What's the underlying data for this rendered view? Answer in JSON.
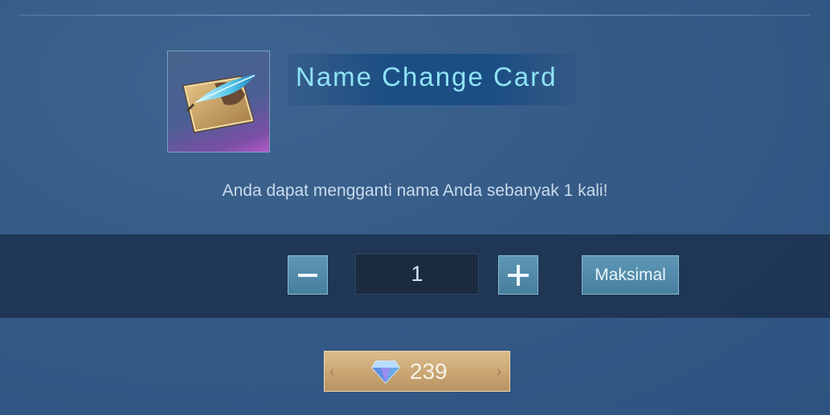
{
  "item": {
    "name": "Name Change Card",
    "description": "Anda dapat mengganti nama Anda sebanyak 1 kali!",
    "icon": "name-change-card-icon"
  },
  "quantity": {
    "value": "1",
    "decrease_icon": "minus-icon",
    "increase_icon": "plus-icon",
    "max_label": "Maksimal"
  },
  "purchase": {
    "price": "239",
    "currency_icon": "diamond-icon"
  },
  "colors": {
    "background": "#355a86",
    "title": "#8fe3f5",
    "button": "#4f88a8",
    "price_button": "#cba774"
  }
}
